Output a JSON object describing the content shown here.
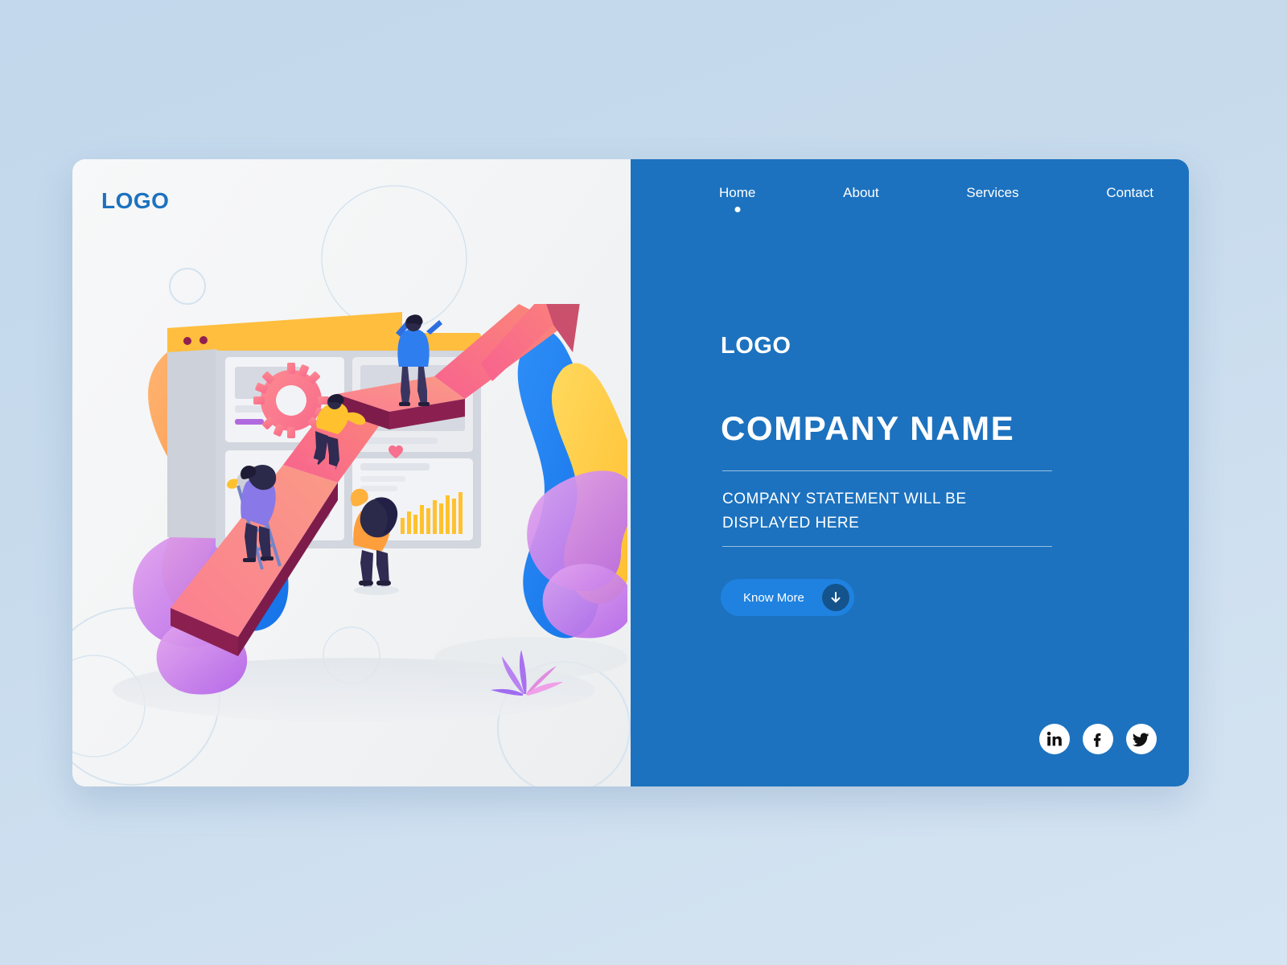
{
  "page": {
    "background_color": "#c6daec",
    "card_left_bg": "#f4f5f6",
    "card_right_bg": "#1c72bf"
  },
  "left_panel": {
    "logo": "LOGO",
    "logo_color": "#1c72bf",
    "illustration_name": "business-growth-arrow-illustration"
  },
  "nav": {
    "items": [
      {
        "label": "Home",
        "active": true
      },
      {
        "label": "About",
        "active": false
      },
      {
        "label": "Services",
        "active": false
      },
      {
        "label": "Contact",
        "active": false
      }
    ]
  },
  "hero": {
    "logo": "LOGO",
    "company_name": "COMPANY NAME",
    "statement": "COMPANY STATEMENT WILL BE DISPLAYED HERE"
  },
  "cta": {
    "label": "Know More",
    "icon": "arrow-down-icon",
    "button_color": "#1f82e0",
    "icon_circle_color": "#14538c"
  },
  "socials": [
    {
      "name": "linkedin",
      "label": "in"
    },
    {
      "name": "facebook",
      "label": "f"
    },
    {
      "name": "twitter",
      "label": "t"
    }
  ]
}
